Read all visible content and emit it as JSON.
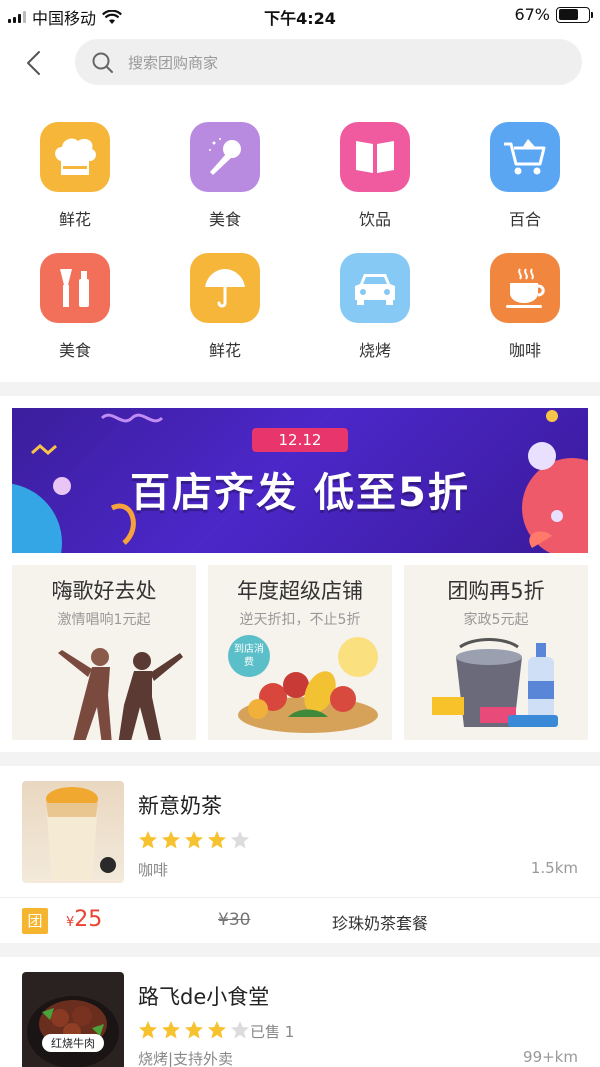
{
  "status_bar": {
    "carrier": "中国移动",
    "time": "下午4:24",
    "battery": "67%",
    "battery_level": 0.67
  },
  "search": {
    "placeholder": "搜索团购商家"
  },
  "categories": [
    {
      "label": "鲜花",
      "icon": "chef-hat-icon",
      "color": "#f6b63a"
    },
    {
      "label": "美食",
      "icon": "microphone-icon",
      "color": "#b88be0"
    },
    {
      "label": "饮品",
      "icon": "book-icon",
      "color": "#f05a9e"
    },
    {
      "label": "百合",
      "icon": "shopping-cart-icon",
      "color": "#5aa6f3"
    },
    {
      "label": "美食",
      "icon": "cosmetics-icon",
      "color": "#f2705a"
    },
    {
      "label": "鲜花",
      "icon": "umbrella-icon",
      "color": "#f6b63a"
    },
    {
      "label": "烧烤",
      "icon": "car-icon",
      "color": "#86c9f4"
    },
    {
      "label": "咖啡",
      "icon": "coffee-cup-icon",
      "color": "#f1863e"
    }
  ],
  "banner": {
    "tag": "12.12",
    "title": "百店齐发 低至5折"
  },
  "promos": [
    {
      "title": "嗨歌好去处",
      "subtitle": "激情唱响1元起"
    },
    {
      "title": "年度超级店铺",
      "subtitle": "逆天折扣，不止5折",
      "badge": "到店消费"
    },
    {
      "title": "团购再5折",
      "subtitle": "家政5元起"
    }
  ],
  "stores": [
    {
      "name": "新意奶茶",
      "rating": 4,
      "category": "咖啡",
      "distance": "1.5km",
      "deal": {
        "badge": "团",
        "currency": "¥",
        "price": "25",
        "original": "¥30",
        "name": "珍珠奶茶套餐"
      }
    },
    {
      "name": "路飞de小食堂",
      "rating": 4,
      "sold": "已售 1",
      "category": "烧烤|支持外卖",
      "distance": "99+km",
      "thumb_label": "红烧牛肉"
    }
  ]
}
